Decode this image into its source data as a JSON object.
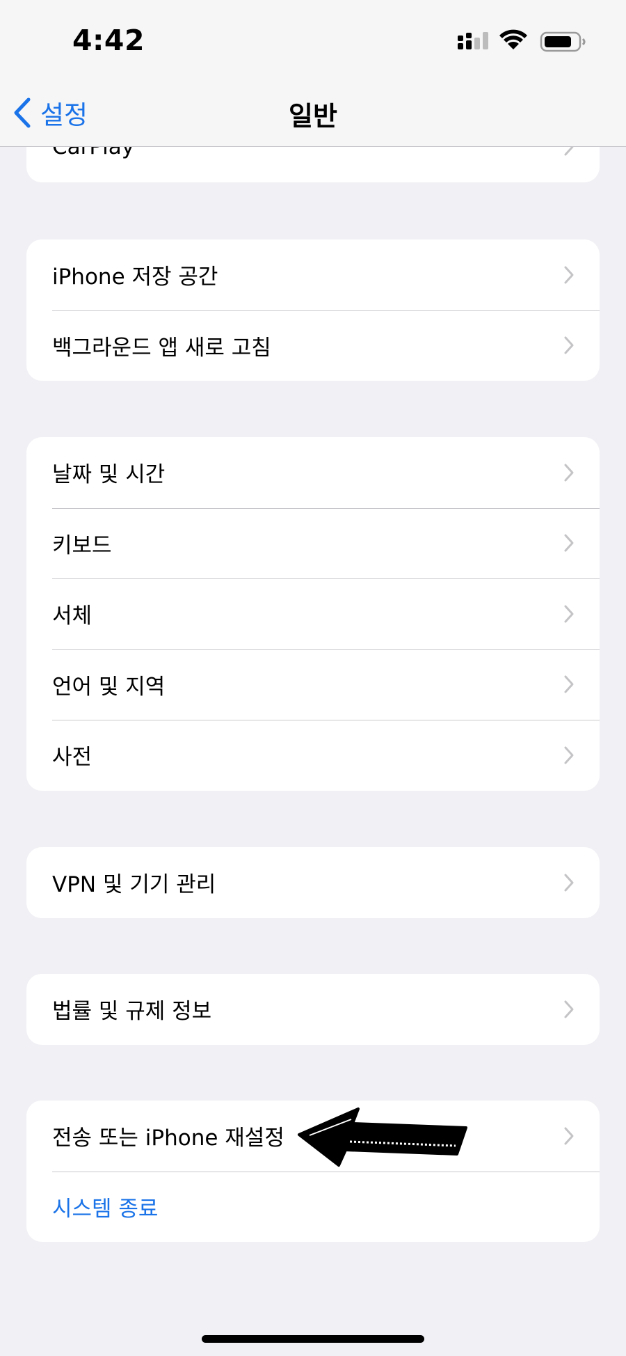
{
  "status_bar": {
    "time": "4:42"
  },
  "nav": {
    "back_label": "설정",
    "title": "일반"
  },
  "groups": [
    {
      "items": [
        {
          "label": "CarPlay"
        }
      ]
    },
    {
      "items": [
        {
          "label": "iPhone 저장 공간"
        },
        {
          "label": "백그라운드 앱 새로 고침"
        }
      ]
    },
    {
      "items": [
        {
          "label": "날짜 및 시간"
        },
        {
          "label": "키보드"
        },
        {
          "label": "서체"
        },
        {
          "label": "언어 및 지역"
        },
        {
          "label": "사전"
        }
      ]
    },
    {
      "items": [
        {
          "label": "VPN 및 기기 관리"
        }
      ]
    },
    {
      "items": [
        {
          "label": "법률 및 규제 정보"
        }
      ]
    },
    {
      "items": [
        {
          "label": "전송 또는 iPhone 재설정"
        },
        {
          "label": "시스템 종료"
        }
      ]
    }
  ],
  "colors": {
    "accent": "#1a73e8",
    "background": "#f0f0f5",
    "separator": "#c8c8cc"
  },
  "icons": {
    "chevron": "chevron-right-icon",
    "back": "chevron-left-icon"
  }
}
